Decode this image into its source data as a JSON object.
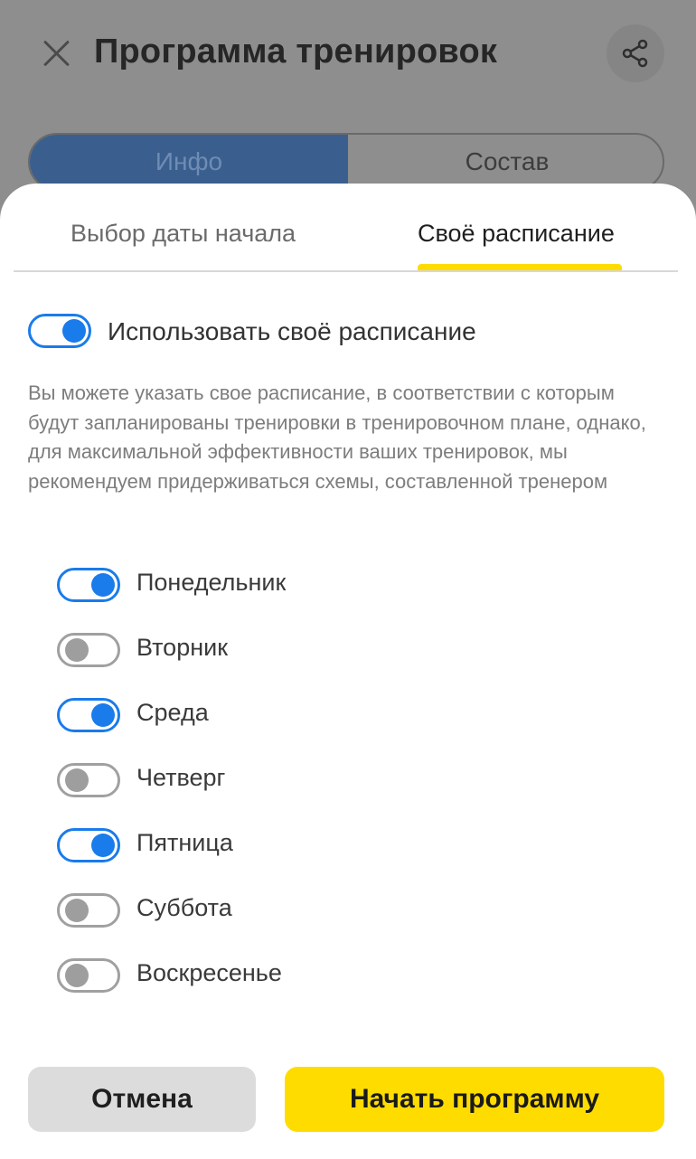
{
  "header": {
    "title": "Программа тренировок"
  },
  "segments": {
    "info_label": "Инфо",
    "composition_label": "Состав"
  },
  "sheet": {
    "tabs": {
      "start_date": "Выбор даты начала",
      "custom_schedule": "Своё расписание",
      "active": "custom_schedule"
    },
    "use_custom": {
      "label": "Использовать своё расписание",
      "enabled": true
    },
    "description": "Вы можете указать свое расписание, в соответствии с которым будут запланированы тренировки в тренировочном плане, однако, для максимальной эффективности ваших тренировок, мы рекомендуем придерживаться схемы, составленной тренером",
    "days": [
      {
        "label": "Понедельник",
        "enabled": true
      },
      {
        "label": "Вторник",
        "enabled": false
      },
      {
        "label": "Среда",
        "enabled": true
      },
      {
        "label": "Четверг",
        "enabled": false
      },
      {
        "label": "Пятница",
        "enabled": true
      },
      {
        "label": "Суббота",
        "enabled": false
      },
      {
        "label": "Воскресенье",
        "enabled": false
      }
    ],
    "buttons": {
      "cancel": "Отмена",
      "start": "Начать программу"
    }
  },
  "colors": {
    "accent": "#1a7bea",
    "primary_button": "#ffdc00",
    "tab_indicator": "#ffdc00"
  }
}
